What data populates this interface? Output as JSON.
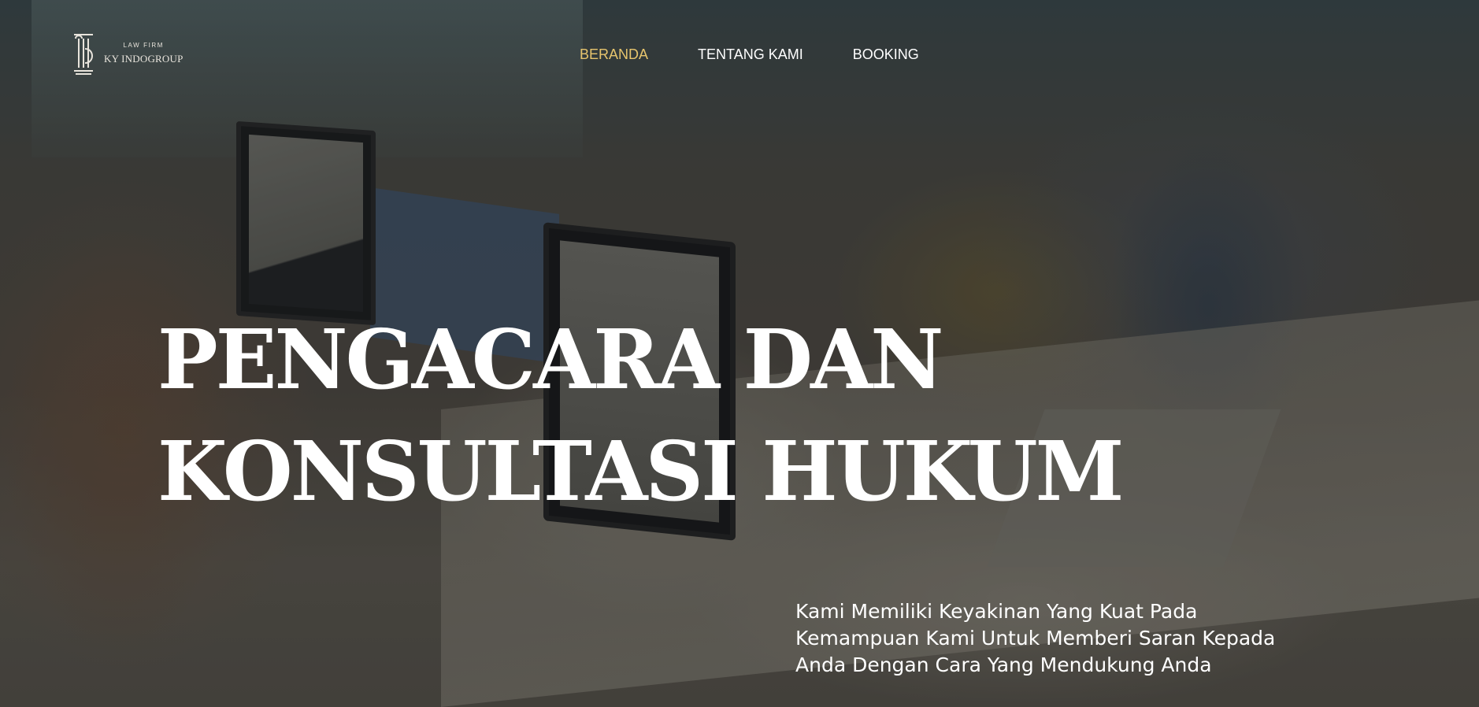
{
  "brand": {
    "tagline": "LAW FIRM",
    "name": "KY INDOGROUP",
    "icon": "pillar-logo-icon"
  },
  "nav": {
    "items": [
      {
        "label": "BERANDA",
        "active": true
      },
      {
        "label": "TENTANG KAMI",
        "active": false
      },
      {
        "label": "BOOKING",
        "active": false
      }
    ],
    "active_color": "#e6c46d"
  },
  "hero": {
    "headline_line1": "PENGACARA DAN",
    "headline_line2": "KONSULTASI HUKUM",
    "subtitle_line1": "Kami Memiliki Keyakinan Yang Kuat Pada",
    "subtitle_line2": "Kemampuan Kami Untuk Memberi Saran Kepada",
    "subtitle_line3": "Anda Dengan Cara Yang Mendukung Anda"
  }
}
